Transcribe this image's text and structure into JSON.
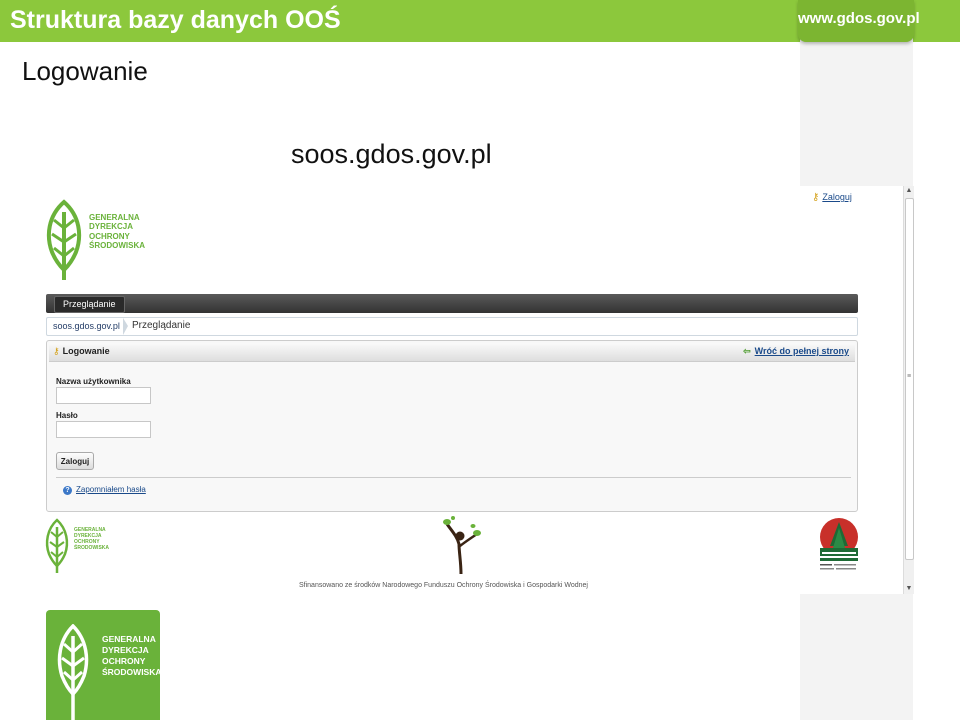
{
  "slide": {
    "title": "Struktura bazy danych OOŚ",
    "brand": "www.gdos.gov.pl",
    "subtitle": "Logowanie",
    "url_caption": "soos.gdos.gov.pl"
  },
  "screenshot": {
    "login_link": "Zaloguj",
    "logo_text": "GENERALNA\nDYREKCJA\nOCHRONY\nŚRODOWISKA",
    "nav_tab": "Przeglądanie",
    "breadcrumb": {
      "home": "soos.gdos.gov.pl",
      "current": "Przeglądanie"
    },
    "panel": {
      "title": "Logowanie",
      "back_link": "Wróć do pełnej strony",
      "username_label": "Nazwa użytkownika",
      "username_value": "",
      "password_label": "Hasło",
      "password_value": "",
      "submit_label": "Zaloguj",
      "forgot_link": "Zapomniałem hasła"
    },
    "footer_funding": "Sfinansowano ze środków Narodowego Funduszu Ochrony Środowiska i Gospodarki Wodnej"
  },
  "colors": {
    "brand_green": "#8cc83c",
    "logo_green": "#6ab23a",
    "link_blue": "#1a4a8a",
    "navbar_dark": "#3a3a3a"
  },
  "icons": {
    "login": "key-icon",
    "back": "arrow-left-icon",
    "help": "question-icon"
  }
}
